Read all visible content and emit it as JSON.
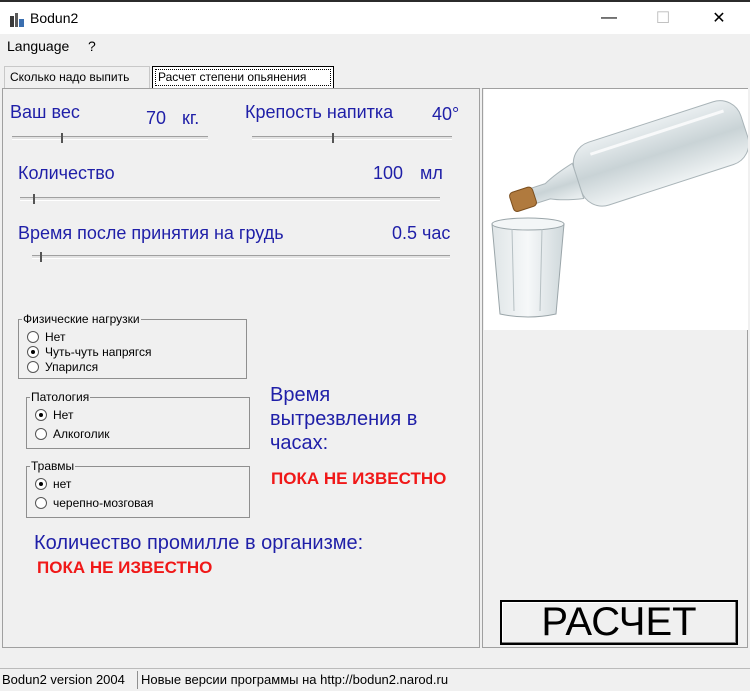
{
  "window": {
    "title": "Bodun2",
    "min_glyph": "—",
    "max_glyph": "☐",
    "close_glyph": "✕"
  },
  "menu": {
    "language": "Language",
    "help": "?"
  },
  "tabs": [
    {
      "label": "Сколько надо выпить",
      "selected": false
    },
    {
      "label": "Расчет степени опьянения",
      "selected": true
    }
  ],
  "inputs": {
    "weight": {
      "label": "Ваш вес",
      "value": "70",
      "unit": "кг.",
      "level": 0.25
    },
    "strength": {
      "label": "Крепость напитка",
      "value": "40°",
      "level": 0.4
    },
    "quantity": {
      "label": "Количество",
      "value": "100",
      "unit": "мл",
      "level": 0.03
    },
    "time": {
      "label": "Время после принятия на грудь",
      "value": "0.5",
      "unit": "час",
      "level": 0.02
    }
  },
  "groups": {
    "physical": {
      "title": "Физические нагрузки",
      "options": [
        "Нет",
        "Чуть-чуть напрягся",
        "Упарился"
      ],
      "selected": 1
    },
    "pathology": {
      "title": "Патология",
      "options": [
        "Нет",
        "Алкоголик"
      ],
      "selected": 0
    },
    "injuries": {
      "title": "Травмы",
      "options": [
        "нет",
        "черепно-мозговая"
      ],
      "selected": 0
    }
  },
  "results": {
    "sober_time_line1": "Время",
    "sober_time_line2": "вытрезвления в",
    "sober_time_line3": "часах:",
    "sober_time_value": "ПОКА НЕ ИЗВЕСТНО",
    "promille_label": "Количество промилле в организме:",
    "promille_value": "ПОКА НЕ ИЗВЕСТНО"
  },
  "calc_button": "РАСЧЕТ",
  "status": {
    "version": "Bodun2 version 2004",
    "message": "Новые версии программы на http://bodun2.narod.ru"
  },
  "colors": {
    "label_blue": "#1f1fa8",
    "result_red": "#f01818"
  }
}
